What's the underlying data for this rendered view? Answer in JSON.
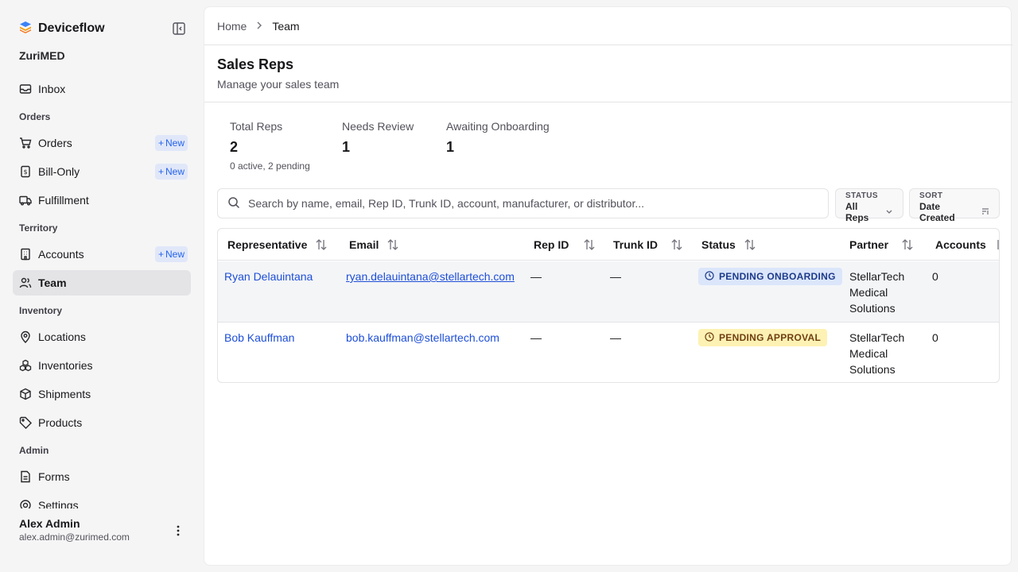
{
  "brand": {
    "name": "Deviceflow"
  },
  "org": "ZuriMED",
  "nav": {
    "inbox": "Inbox",
    "section_orders": "Orders",
    "orders": "Orders",
    "bill_only": "Bill-Only",
    "fulfillment": "Fulfillment",
    "section_territory": "Territory",
    "accounts": "Accounts",
    "team": "Team",
    "section_inventory": "Inventory",
    "locations": "Locations",
    "inventories": "Inventories",
    "shipments": "Shipments",
    "products": "Products",
    "section_admin": "Admin",
    "forms": "Forms",
    "settings": "Settings",
    "new_label": "New"
  },
  "user": {
    "name": "Alex Admin",
    "email": "alex.admin@zurimed.com"
  },
  "breadcrumb": {
    "home": "Home",
    "current": "Team"
  },
  "page": {
    "title": "Sales Reps",
    "subtitle": "Manage your sales team"
  },
  "stats": {
    "total_label": "Total Reps",
    "total_value": "2",
    "total_note": "0 active, 2 pending",
    "review_label": "Needs Review",
    "review_value": "1",
    "onboarding_label": "Awaiting Onboarding",
    "onboarding_value": "1"
  },
  "search": {
    "placeholder": "Search by name, email, Rep ID, Trunk ID, account, manufacturer, or distributor..."
  },
  "filters": {
    "status_label": "STATUS",
    "status_value": "All Reps",
    "sort_label": "SORT",
    "sort_value": "Date Created"
  },
  "table": {
    "columns": [
      "Representative",
      "Email",
      "Rep ID",
      "Trunk ID",
      "Status",
      "Partner",
      "Accounts"
    ],
    "rows": [
      {
        "name": "Ryan Delauintana",
        "email": "ryan.delauintana@stellartech.com",
        "rep_id": "—",
        "trunk_id": "—",
        "status": "PENDING ONBOARDING",
        "partner_l1": "StellarTech",
        "partner_l2": "Medical",
        "partner_l3": "Solutions",
        "accounts": "0"
      },
      {
        "name": "Bob Kauffman",
        "email": "bob.kauffman@stellartech.com",
        "rep_id": "—",
        "trunk_id": "—",
        "status": "PENDING APPROVAL",
        "partner_l1": "StellarTech",
        "partner_l2": "Medical",
        "partner_l3": "Solutions",
        "accounts": "0"
      }
    ]
  },
  "colors": {
    "accent": "#2563eb",
    "onboarding_badge": "#dbe6fb",
    "approval_badge": "#fdf2b3"
  }
}
